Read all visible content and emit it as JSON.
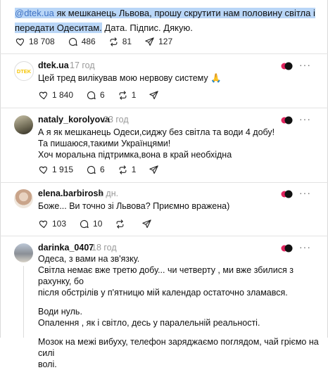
{
  "post": {
    "mention": "@dtek.ua",
    "text_highlighted": " як мешканець Львова, прошу скрутити нам половину світла і передати Одеситам.",
    "text_rest": " Дата. Підпис. Дякую.",
    "likes": "18 708",
    "comments": "486",
    "reposts": "81",
    "shares": "127"
  },
  "replies": [
    {
      "username": "dtek.ua",
      "time": "17 год",
      "lines": [
        "Цей тред вилікував мою нервову систему 🙏"
      ],
      "likes": "1 840",
      "comments": "6",
      "reposts": "1"
    },
    {
      "username": "nataly_korolyova",
      "time": "23 год",
      "lines": [
        "А я як мешканець Одеси,сиджу без світла та води 4 добу!",
        "Та пишаюся,такими Українцями!",
        "Хоч моральна підтримка,вона в край необхідна"
      ],
      "likes": "1 915",
      "comments": "6",
      "reposts": "1"
    },
    {
      "username": "elena.barbirosh",
      "time": "1 дн.",
      "lines": [
        "Боже... Ви точно зі Львова? Приємно вражена)"
      ],
      "likes": "103",
      "comments": "10",
      "reposts": ""
    },
    {
      "username": "darinka_0407",
      "time": "18 год",
      "lines": [
        "Одеса, з вами на зв'язку.",
        "Світла немає вже третю добу... чи четверту , ми вже збилися з рахунку, бо",
        "після обстрілів у п'ятницю мій календар остаточно зламався.",
        "Води нуль.",
        "Опалення , як і світло, десь у паралельній реальності.",
        "Мозок на межі вибуху, телефон заряджаємо поглядом, чай гріємо на силі",
        "волі."
      ]
    }
  ],
  "colors": {
    "highlight": "#b9d6f7",
    "mention": "#3f72c4",
    "time": "#999999",
    "dtek_yellow": "#f5c400"
  },
  "icons": [
    "heart-icon",
    "comment-icon",
    "repost-icon",
    "share-icon",
    "more-icon",
    "reaction-badge-icon"
  ]
}
